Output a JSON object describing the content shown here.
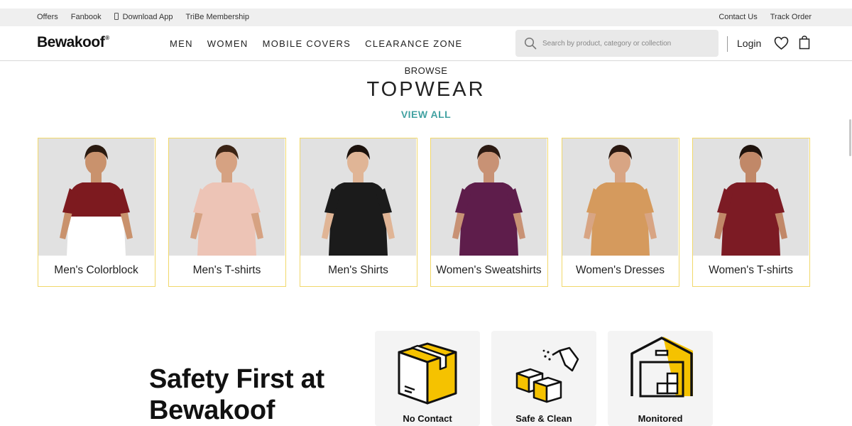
{
  "topbar": {
    "left_links": [
      "Offers",
      "Fanbook",
      "Download App",
      "TriBe Membership"
    ],
    "right_links": [
      "Contact Us",
      "Track Order"
    ]
  },
  "header": {
    "brand": "Bewakoof",
    "brand_mark": "®",
    "nav": [
      "MEN",
      "WOMEN",
      "MOBILE COVERS",
      "CLEARANCE ZONE"
    ],
    "search_placeholder": "Search by product, category or collection",
    "login_label": "Login",
    "icons": [
      "search-icon",
      "wishlist-heart-icon",
      "shopping-bag-icon"
    ]
  },
  "browse": {
    "kicker": "BROWSE",
    "title": "TOPWEAR",
    "view_all": "VIEW ALL"
  },
  "categories": [
    {
      "label": "Men's Colorblock",
      "top": "#7d1a1f",
      "bottom": "#ffffff",
      "skin": "#c9926d",
      "hair": "#2a1a10"
    },
    {
      "label": "Men's T-shirts",
      "top": "#edc4b6",
      "bottom": "#edc4b6",
      "skin": "#d6a282",
      "hair": "#3b2415"
    },
    {
      "label": "Men's Shirts",
      "top": "#1b1b1b",
      "bottom": "#1b1b1b",
      "skin": "#e0b596",
      "hair": "#1c120c"
    },
    {
      "label": "Women's Sweatshirts",
      "top": "#5e1d4b",
      "bottom": "#5e1d4b",
      "skin": "#c89275",
      "hair": "#2c1a12"
    },
    {
      "label": "Women's Dresses",
      "top": "#d59a5d",
      "bottom": "#d59a5d",
      "skin": "#d8a584",
      "hair": "#2a1810"
    },
    {
      "label": "Women's T-shirts",
      "top": "#7c1b24",
      "bottom": "#7c1b24",
      "skin": "#c18868",
      "hair": "#1e120c"
    }
  ],
  "safety": {
    "line1": "Safety First at",
    "line2": "Bewakoof",
    "items": [
      {
        "icon": "box-icon",
        "caption": "No Contact"
      },
      {
        "icon": "sanitize-spray-icon",
        "caption": "Safe & Clean"
      },
      {
        "icon": "warehouse-icon",
        "caption": "Monitored"
      }
    ]
  },
  "colors": {
    "accent": "#42a2a2",
    "card_border": "#f1d86a",
    "safety_yellow": "#f5c200"
  }
}
